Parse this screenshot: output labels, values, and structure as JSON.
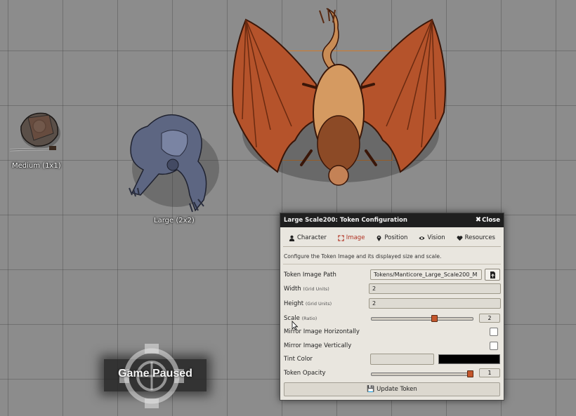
{
  "tokens": {
    "medium_label": "Medium (1x1)",
    "large_label": "Large (2x2)"
  },
  "game_paused": {
    "text": "Game Paused"
  },
  "dialog": {
    "title": "Large Scale200: Token Configuration",
    "close_label": "Close",
    "tabs": [
      {
        "label": "Character",
        "icon": "user-icon"
      },
      {
        "label": "Image",
        "icon": "expand-icon",
        "active": true
      },
      {
        "label": "Position",
        "icon": "map-marker-icon"
      },
      {
        "label": "Vision",
        "icon": "eye-icon"
      },
      {
        "label": "Resources",
        "icon": "heart-icon"
      }
    ],
    "hint": "Configure the Token Image and its displayed size and scale.",
    "fields": {
      "image_path": {
        "label": "Token Image Path",
        "value": "Tokens/Manticore_Large_Scale200_M"
      },
      "width": {
        "label": "Width",
        "unit": "(Grid Units)",
        "value": "2"
      },
      "height": {
        "label": "Height",
        "unit": "(Grid Units)",
        "value": "2"
      },
      "scale": {
        "label": "Scale",
        "unit": "(Ratio)",
        "value": "2",
        "fraction": 0.63
      },
      "mirror_h": {
        "label": "Mirror Image Horizontally",
        "checked": false
      },
      "mirror_v": {
        "label": "Mirror Image Vertically",
        "checked": false
      },
      "tint": {
        "label": "Tint Color",
        "value": "",
        "color": "#000000"
      },
      "opacity": {
        "label": "Token Opacity",
        "value": "1",
        "fraction": 1.0
      }
    },
    "update_label": "Update Token"
  }
}
